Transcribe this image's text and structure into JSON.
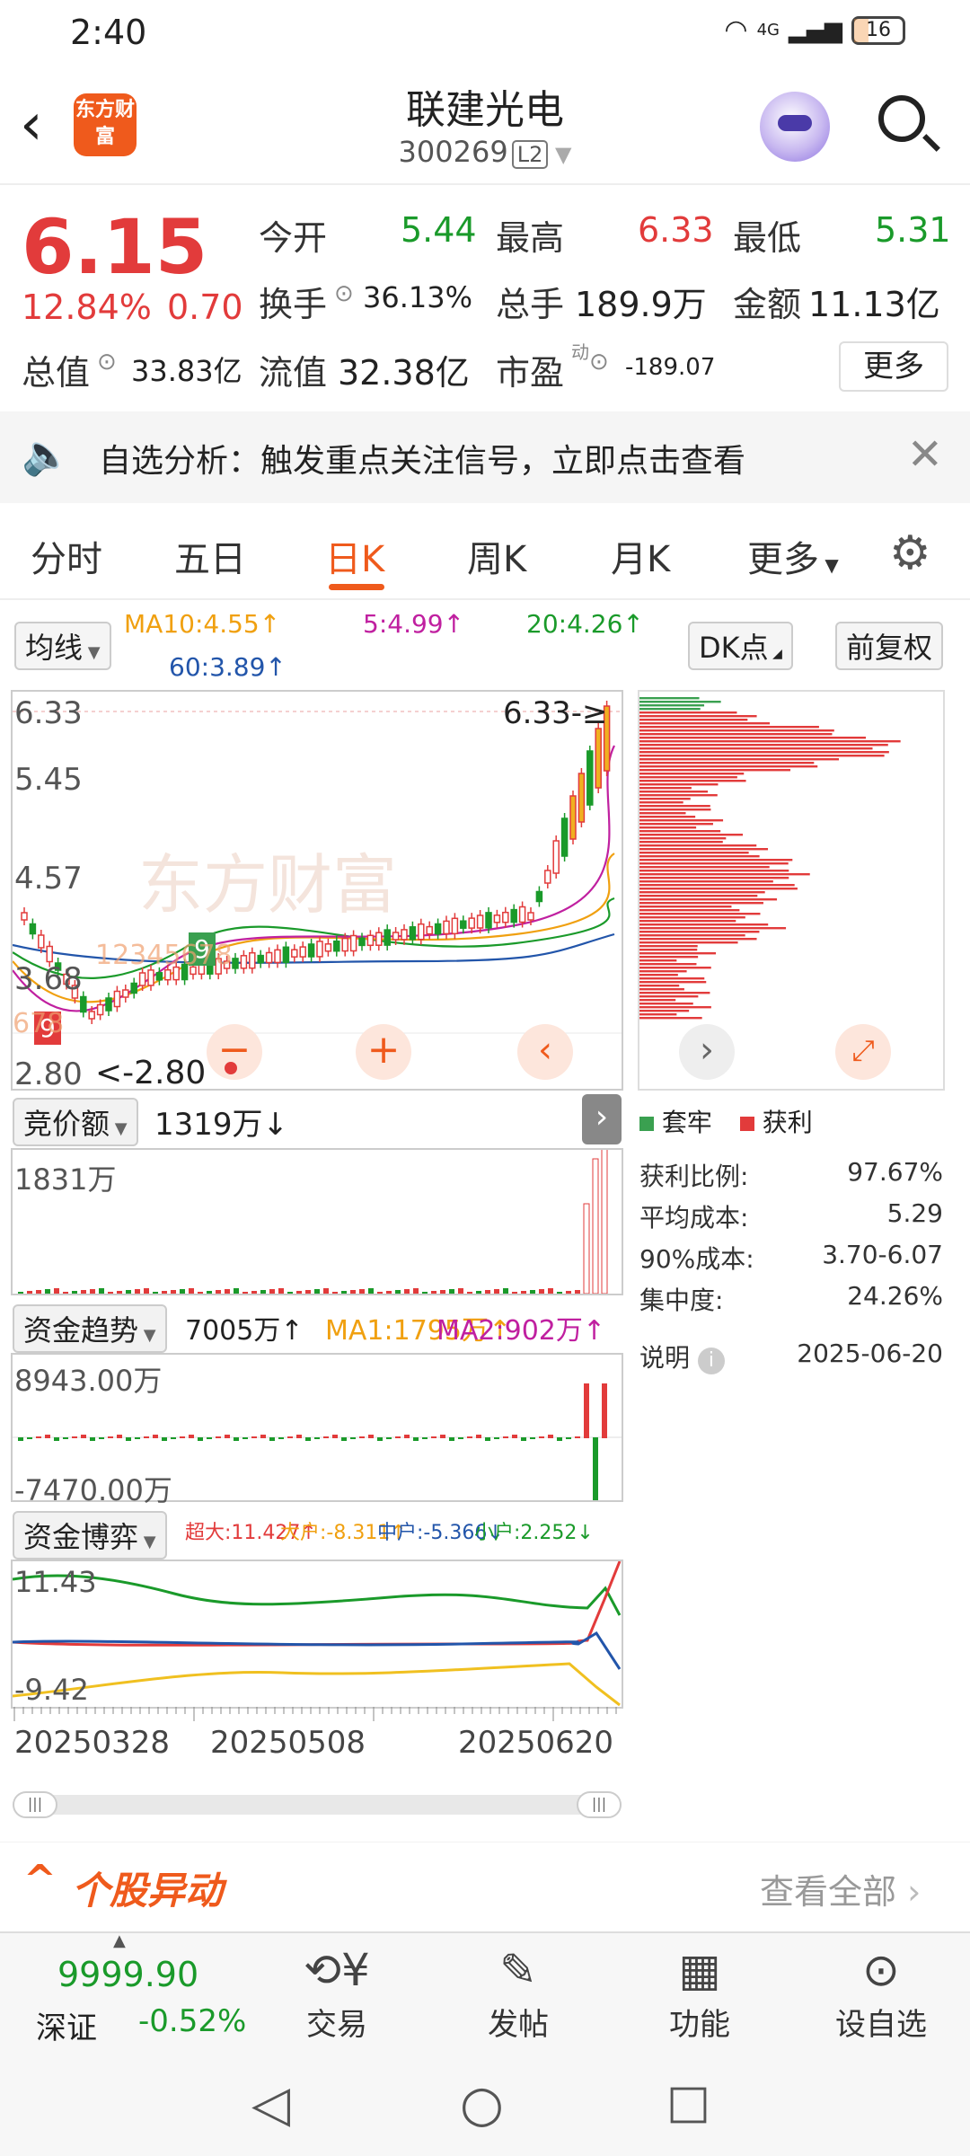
{
  "status_bar": {
    "time": "2:40",
    "network": "4G",
    "battery": "16"
  },
  "header": {
    "logo_text": "东方财富",
    "name": "联建光电",
    "code": "300269",
    "level": "L2"
  },
  "quote": {
    "price": "6.15",
    "change_pct": "12.84%",
    "change": "0.70",
    "open_label": "今开",
    "open": "5.44",
    "high_label": "最高",
    "high": "6.33",
    "low_label": "最低",
    "low": "5.31",
    "turnover_label": "换手",
    "turnover": "36.13%",
    "volume_label": "总手",
    "volume": "189.9万",
    "amount_label": "金额",
    "amount": "11.13亿",
    "mktcap_label": "总值",
    "mktcap": "33.83亿",
    "float_label": "流值",
    "float": "32.38亿",
    "pe_label": "市盈",
    "pe_sup": "动",
    "pe": "-189.07",
    "more": "更多"
  },
  "banner": {
    "text": "自选分析：触发重点关注信号，立即点击查看",
    "close": "✕"
  },
  "tabs": [
    {
      "label": "分时"
    },
    {
      "label": "五日"
    },
    {
      "label": "日K"
    },
    {
      "label": "周K"
    },
    {
      "label": "月K"
    },
    {
      "label": "更多"
    }
  ],
  "active_tab": "日K",
  "ma": {
    "selector": "均线",
    "ma10": "MA10:4.55↑",
    "ma5": "5:4.99↑",
    "ma20": "20:4.26↑",
    "ma60": "60:3.89↑",
    "dk": "DK点",
    "fq": "前复权",
    "colors": {
      "ma5": "#c020a0",
      "ma10": "#f0a010",
      "ma20": "#1a9a2a",
      "ma60": "#2255aa",
      "up": "#e23b3b",
      "down": "#1a9a2a"
    }
  },
  "kline": {
    "ticks": [
      "6.33",
      "5.45",
      "4.57",
      "3.68",
      "2.80"
    ],
    "high_marker": "6.33",
    "low_marker": "<-2.80",
    "watermark": "东方财富",
    "badges": [
      "9",
      "9"
    ]
  },
  "chip": {
    "legend_hold": "套牢",
    "legend_profit": "获利",
    "rows": [
      {
        "label": "获利比例:",
        "value": "97.67%"
      },
      {
        "label": "平均成本:",
        "value": "5.29"
      },
      {
        "label": "90%成本:",
        "value": "3.70-6.07"
      },
      {
        "label": "集中度:",
        "value": "24.26%"
      }
    ],
    "note": "说明",
    "date": "2025-06-20"
  },
  "auction": {
    "selector": "竞价额",
    "value": "1319万↓",
    "tick": "1831万"
  },
  "fund_trend": {
    "selector": "资金趋势",
    "value": "7005万↑",
    "ma1": "MA1:1795万↑",
    "ma2": "MA2:902万↑",
    "top": "8943.00万",
    "bottom": "-7470.00万"
  },
  "fund_game": {
    "selector": "资金博弈",
    "super": "超大:11.427↑",
    "large": "大户:-8.311↑",
    "mid": "中户:-5.366↓",
    "small": "小户:2.252↓",
    "top": "11.43",
    "bottom": "-9.42"
  },
  "dates": [
    "20250328",
    "20250508",
    "20250620"
  ],
  "yidong": {
    "title": "个股异动",
    "link": "查看全部"
  },
  "bottom_nav": {
    "index_value": "9999.90",
    "index_name": "深证",
    "index_change": "-0.52%",
    "items": [
      {
        "label": "交易"
      },
      {
        "label": "发帖"
      },
      {
        "label": "功能"
      },
      {
        "label": "设自选"
      }
    ]
  }
}
